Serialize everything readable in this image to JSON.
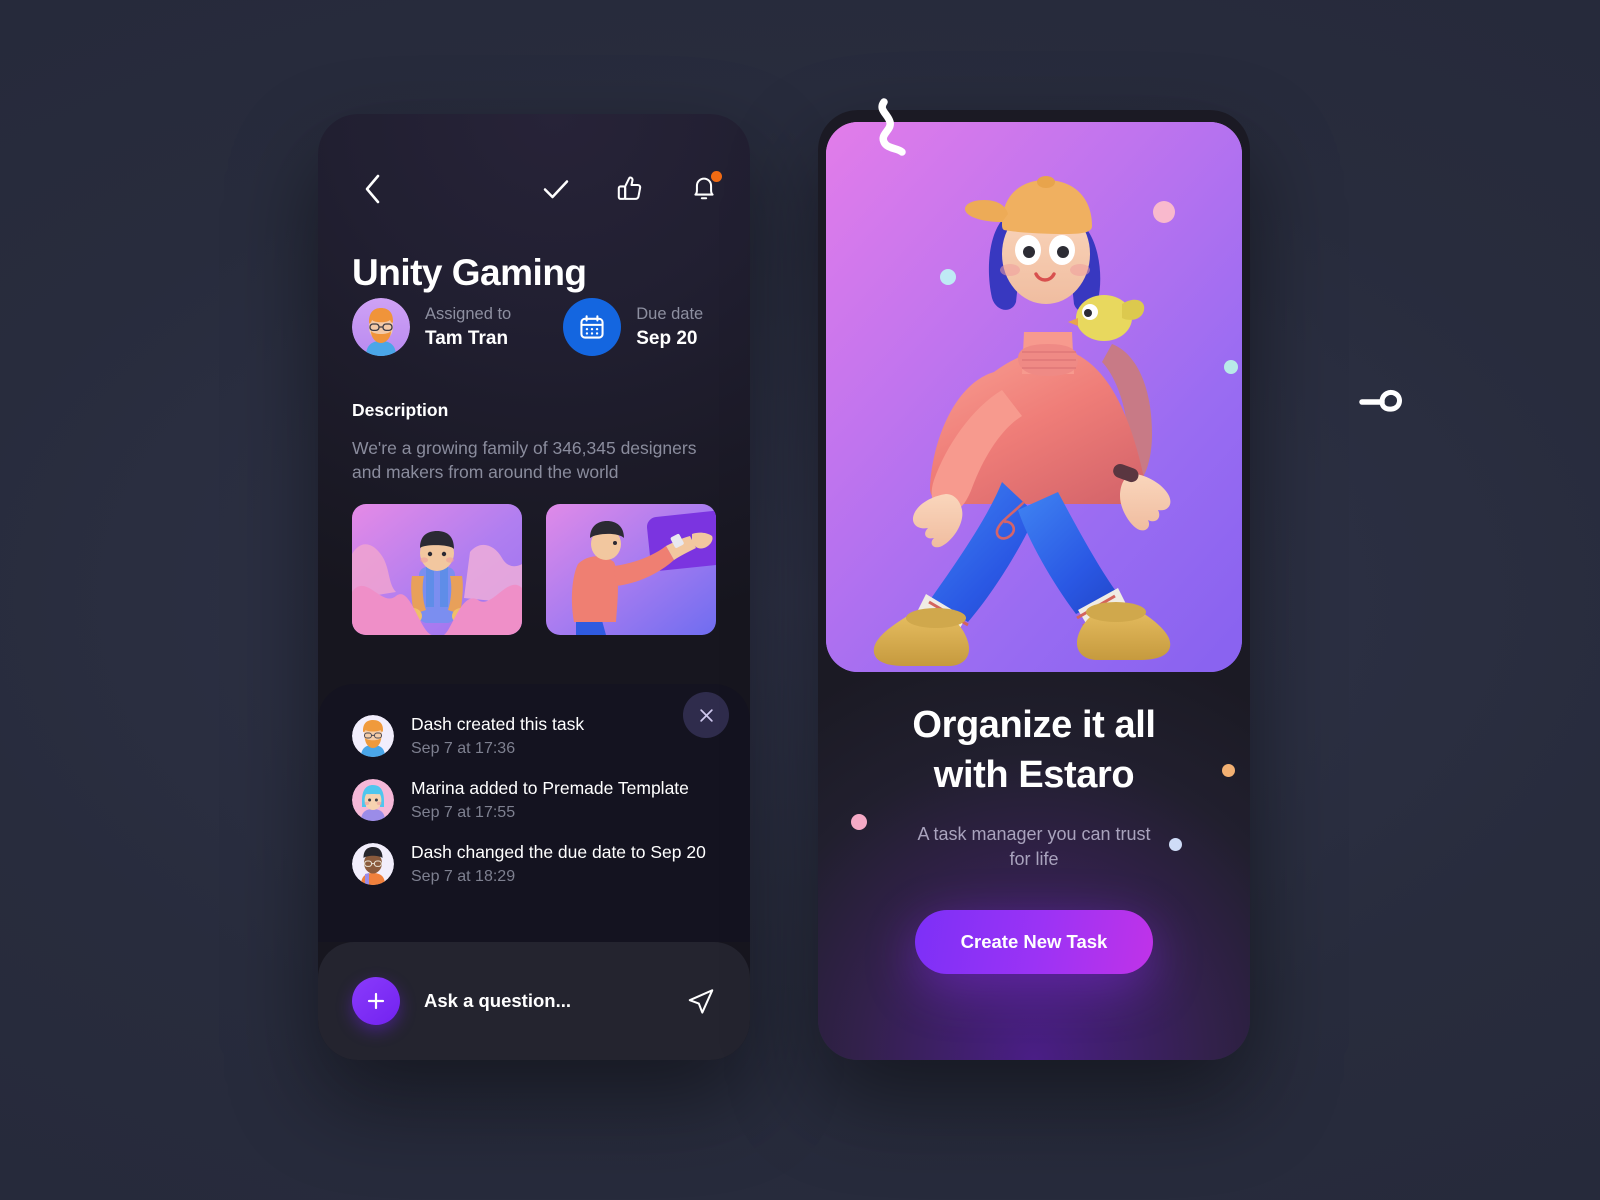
{
  "background": {
    "color": "#2a2e40"
  },
  "left_panel": {
    "toolbar": {
      "back_icon": "chevron-left-icon",
      "actions": [
        {
          "icon": "check-icon",
          "name": "mark-complete"
        },
        {
          "icon": "thumbs-up-icon",
          "name": "like"
        },
        {
          "icon": "bell-icon",
          "name": "notifications",
          "has_badge": true,
          "badge_color": "#f06a13"
        }
      ]
    },
    "task_title": "Unity Gaming",
    "assigned": {
      "label": "Assigned to",
      "value": "Tam Tran",
      "avatar": "avatar-tam-tran"
    },
    "due": {
      "label": "Due date",
      "value": "Sep 20",
      "icon": "calendar-icon",
      "icon_bg": "#1466e0"
    },
    "description": {
      "heading": "Description",
      "body": "We're a growing family of 346,345 designers and makers from around the world"
    },
    "attachments": [
      {
        "name": "thumbnail-hiker"
      },
      {
        "name": "thumbnail-board"
      }
    ],
    "activity": {
      "close_icon": "close-icon",
      "items": [
        {
          "avatar": "avatar-dash",
          "text": "Dash created this task",
          "time": "Sep 7 at 17:36"
        },
        {
          "avatar": "avatar-marina",
          "text": "Marina added to Premade Template",
          "time": "Sep 7 at 17:55"
        },
        {
          "avatar": "avatar-dash-2",
          "text": "Dash changed the due date to Sep 20",
          "time": "Sep 7 at 18:29"
        }
      ]
    },
    "composer": {
      "add_icon": "plus-icon",
      "placeholder": "Ask a question...",
      "send_icon": "send-icon",
      "accent": "#7222f0"
    }
  },
  "right_panel": {
    "hero_image": "illustration-walking-character",
    "headline_line1": "Organize it all",
    "headline_line2": "with Estaro",
    "subhead": "A task manager you can trust for life",
    "cta_label": "Create New Task",
    "cta_gradient": [
      "#7c30f7",
      "#c033e8"
    ],
    "dots": [
      {
        "color": "#f0a0c0",
        "name": "deco-dot-pink"
      },
      {
        "color": "#f2b072",
        "name": "deco-dot-orange"
      },
      {
        "color": "#c6d2f2",
        "name": "deco-dot-blue"
      }
    ]
  },
  "decorations": [
    {
      "name": "squiggle-top",
      "color": "#ffffff"
    },
    {
      "name": "curl-right",
      "color": "#ffffff"
    }
  ]
}
